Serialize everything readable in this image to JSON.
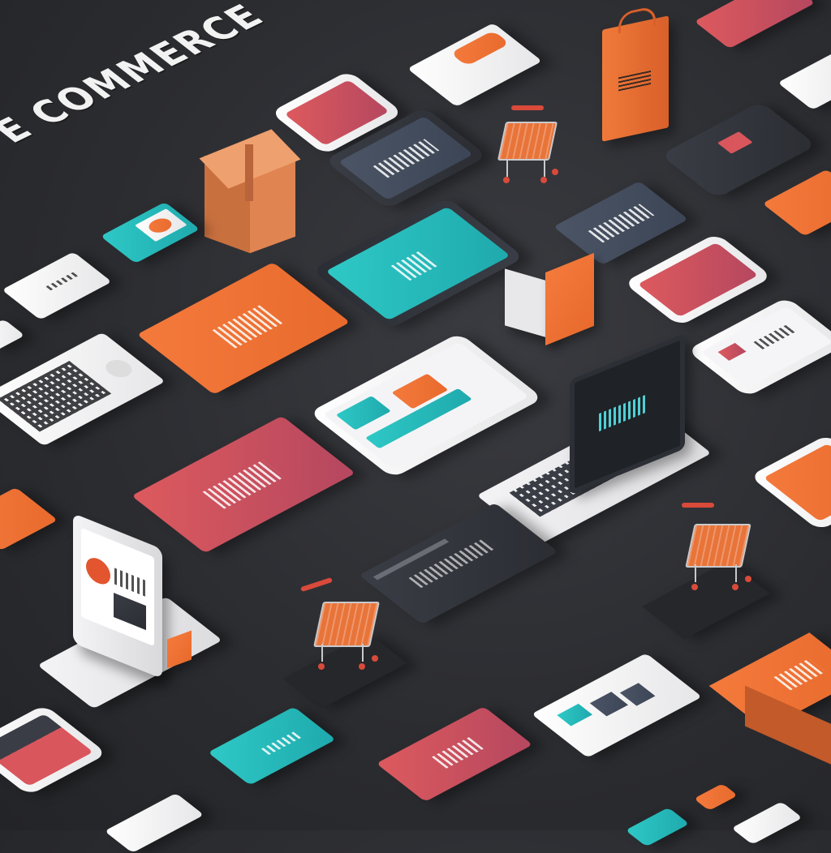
{
  "hero": {
    "title": "E COMMERCE"
  },
  "colors": {
    "background": "#2c2d31",
    "accent_orange": "#f47a3c",
    "accent_red": "#d9565d",
    "accent_teal": "#2ec9c6",
    "card_white": "#f4f4f6",
    "slate": "#4b5566"
  },
  "icons": [
    "package-box-icon",
    "shopping-cart-icon",
    "shopping-bag-icon",
    "smartphone-icon",
    "laptop-icon",
    "monitor-icon",
    "tablet-icon"
  ]
}
